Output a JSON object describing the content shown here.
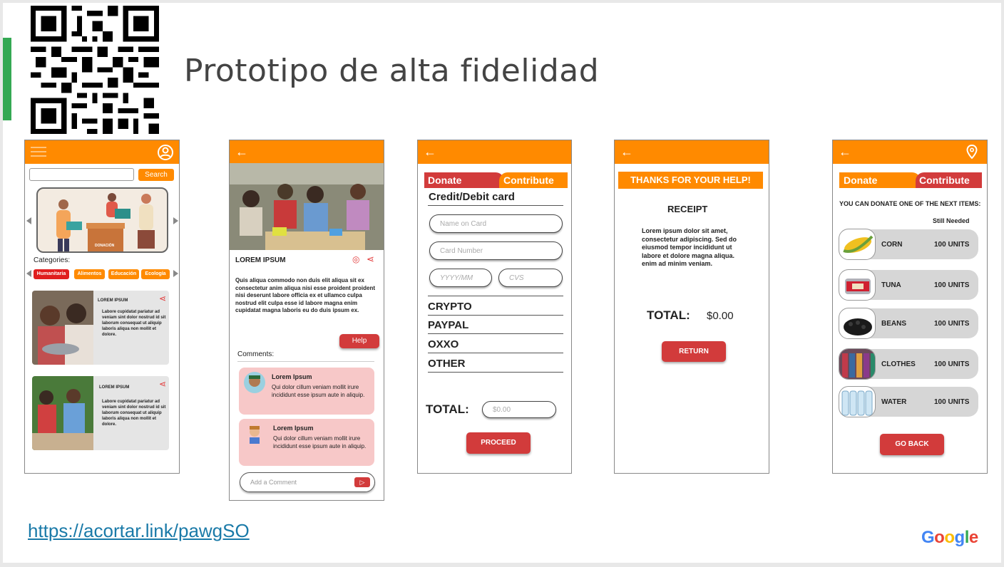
{
  "slide": {
    "title": "Prototipo de alta fidelidad",
    "link": "https://acortar.link/pawgSO",
    "brand": "Google"
  },
  "colors": {
    "accent_green": "#34a853",
    "orange": "#ff8a00",
    "red": "#d23b3b",
    "link": "#1a7aa8"
  },
  "screen1": {
    "search_button": "Search",
    "banner_label": "DONACIÓN",
    "categories_label": "Categories:",
    "categories": [
      "Humanitaria",
      "Alimentos",
      "Educación",
      "Ecología"
    ],
    "cards": [
      {
        "title": "LOREM IPSUM",
        "body": "Labore cupidatat pariatur ad veniam sint dolor nostrud id sit laborum consequat ut aliquip laboris aliqua non mollit et dolore."
      },
      {
        "title": "LOREM IPSUM",
        "body": "Labore cupidatat pariatur ad veniam sint dolor nostrud id sit laborum consequat ut aliquip laboris aliqua non mollit et dolore."
      }
    ]
  },
  "screen2": {
    "title": "LOREM IPSUM",
    "body": "Quis aliqua commodo non duis elit aliqua sit ex consectetur anim aliqua nisi esse proident proident nisi deserunt labore officia ex et ullamco culpa nostrud elit culpa esse id labore magna enim cupidatat magna laboris eu do duis ipsum ex.",
    "help_button": "Help",
    "comments_label": "Comments:",
    "comments": [
      {
        "author": "Lorem Ipsum",
        "text": "Qui dolor cillum veniam mollit irure incididunt esse ipsum aute in aliquip."
      },
      {
        "author": "Lorem Ipsum",
        "text": "Qui dolor cillum veniam mollit irure incididunt esse ipsum aute in aliquip."
      }
    ],
    "comment_placeholder": "Add a Comment"
  },
  "screen3": {
    "tab_donate": "Donate",
    "tab_contribute": "Contribute",
    "heading": "Credit/Debit card",
    "name_placeholder": "Name on Card",
    "card_placeholder": "Card Number",
    "date_placeholder": "YYYY/MM",
    "cvs_placeholder": "CVS",
    "options": [
      "CRYPTO",
      "PAYPAL",
      "OXXO",
      "OTHER"
    ],
    "total_label": "TOTAL:",
    "total_placeholder": "$0.00",
    "proceed_button": "PROCEED"
  },
  "screen4": {
    "thanks": "THANKS FOR YOUR HELP!",
    "receipt": "RECEIPT",
    "body": "Lorem ipsum dolor sit amet, consectetur adipiscing. Sed do eiusmod tempor incididunt ut labore et dolore magna aliqua. enim ad minim veniam.",
    "total_label": "TOTAL:",
    "total_value": "$0.00",
    "return_button": "RETURN"
  },
  "screen5": {
    "tab_donate": "Donate",
    "tab_contribute": "Contribute",
    "intro": "YOU CAN DONATE ONE OF THE NEXT ITEMS:",
    "still_needed": "Still Needed",
    "items": [
      {
        "name": "CORN",
        "units": "100 UNITS"
      },
      {
        "name": "TUNA",
        "units": "100 UNITS"
      },
      {
        "name": "BEANS",
        "units": "100 UNITS"
      },
      {
        "name": "CLOTHES",
        "units": "100 UNITS"
      },
      {
        "name": "WATER",
        "units": "100 UNITS"
      }
    ],
    "go_back_button": "GO BACK"
  }
}
